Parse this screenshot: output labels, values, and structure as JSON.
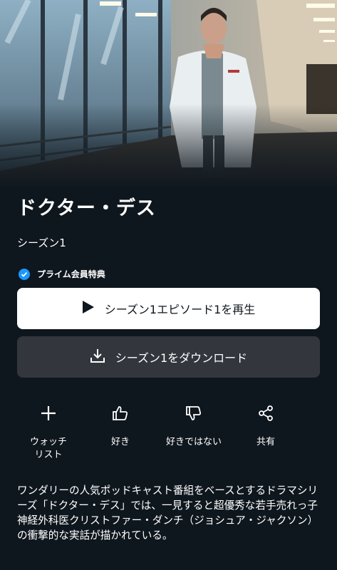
{
  "show": {
    "title": "ドクター・デス",
    "season": "シーズン1",
    "badge": "プライム会員特典"
  },
  "buttons": {
    "play_label": "シーズン1エピソード1を再生",
    "download_label": "シーズン1をダウンロード"
  },
  "actions": [
    {
      "label": "ウォッチ\nリスト",
      "icon": "plus-icon"
    },
    {
      "label": "好き",
      "icon": "thumbs-up-icon"
    },
    {
      "label": "好きではない",
      "icon": "thumbs-down-icon"
    },
    {
      "label": "共有",
      "icon": "share-icon"
    }
  ],
  "description": "ワンダリーの人気ポッドキャスト番組をベースとするドラマシリーズ「ドクター・デス」では、一見すると超優秀な若手売れっ子神経外科医クリストファー・ダンチ（ジョシュア・ジャクソン）の衝撃的な実話が描かれている。",
  "colors": {
    "background": "#0f171e",
    "badge": "#1a98ff",
    "play_button": "#ffffff",
    "download_button": "#33373d"
  }
}
